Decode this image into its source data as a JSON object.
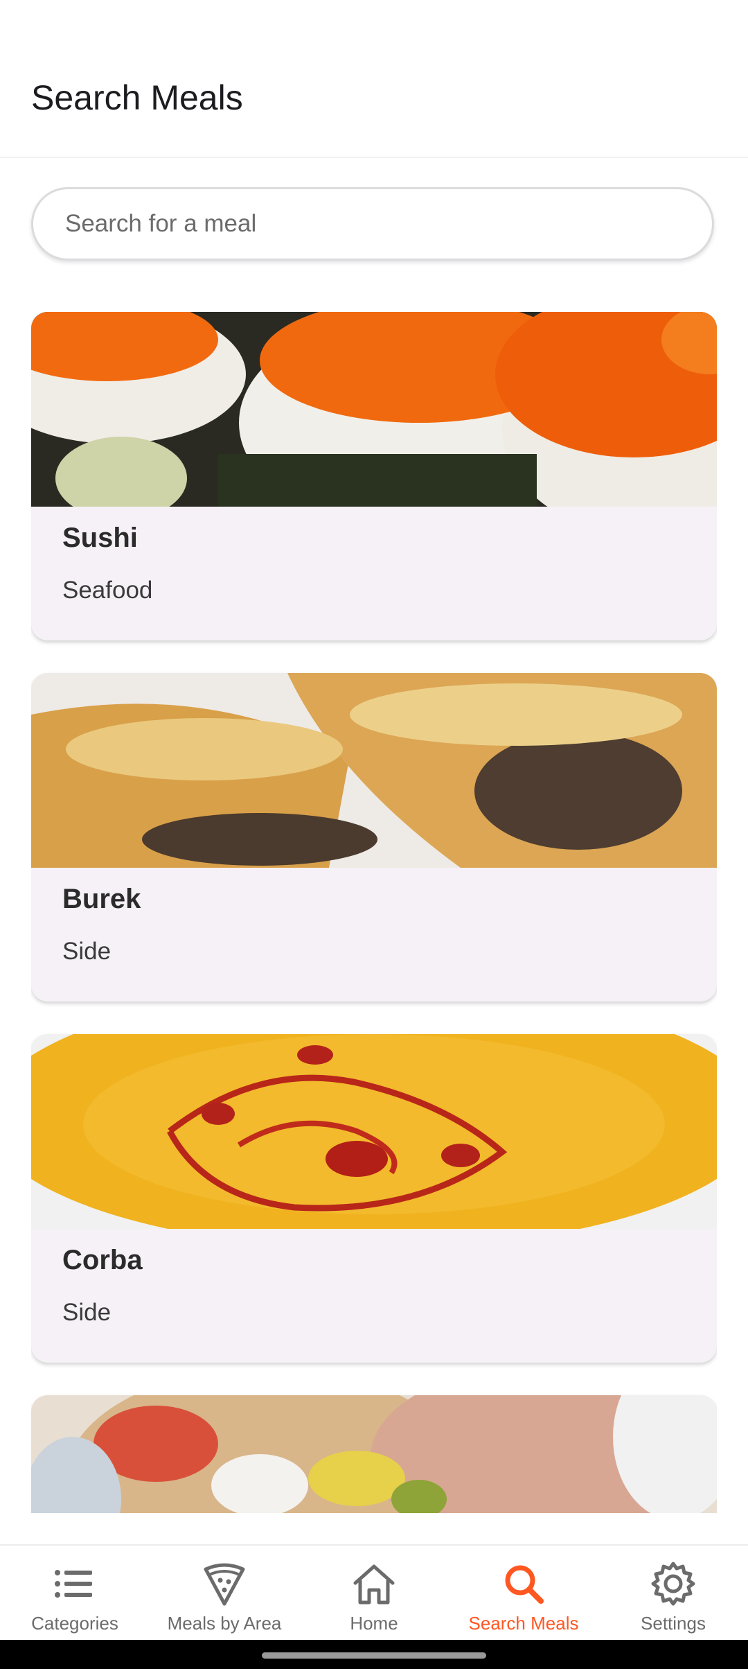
{
  "header": {
    "title": "Search Meals"
  },
  "search": {
    "placeholder": "Search for a meal",
    "value": ""
  },
  "meals": [
    {
      "name": "Sushi",
      "category": "Seafood"
    },
    {
      "name": "Burek",
      "category": "Side"
    },
    {
      "name": "Corba",
      "category": "Side"
    },
    {
      "name": "",
      "category": ""
    }
  ],
  "bottom_nav": {
    "items": [
      {
        "label": "Categories",
        "icon": "list-icon",
        "active": false
      },
      {
        "label": "Meals by Area",
        "icon": "pizza-slice-icon",
        "active": false
      },
      {
        "label": "Home",
        "icon": "home-icon",
        "active": false
      },
      {
        "label": "Search Meals",
        "icon": "search-icon",
        "active": true
      },
      {
        "label": "Settings",
        "icon": "gear-icon",
        "active": false
      }
    ],
    "active_color": "#ff5722",
    "inactive_color": "#6b6b6b"
  }
}
